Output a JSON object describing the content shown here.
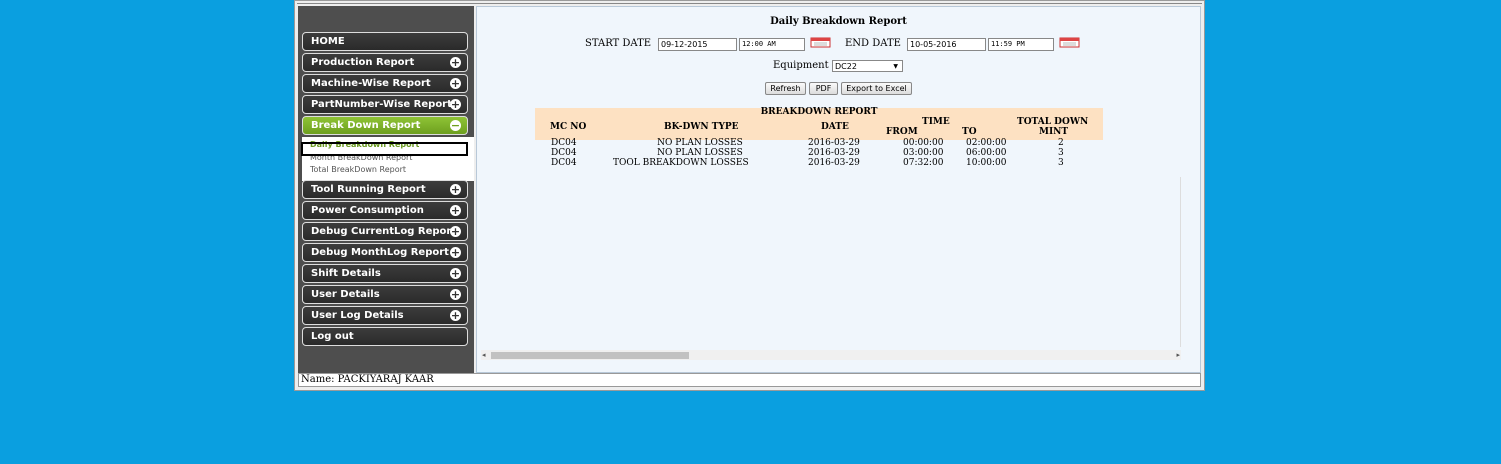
{
  "sidebar": {
    "items": [
      {
        "label": "HOME",
        "icon": ""
      },
      {
        "label": "Production Report",
        "icon": "plus-icon"
      },
      {
        "label": "Machine-Wise Report",
        "icon": "plus-icon"
      },
      {
        "label": "PartNumber-Wise Report",
        "icon": "plus-icon"
      },
      {
        "label": "Break Down Report",
        "icon": "minus-icon"
      },
      {
        "label": "Tool Running Report",
        "icon": "plus-icon"
      },
      {
        "label": "Power Consumption",
        "icon": "plus-icon"
      },
      {
        "label": "Debug CurrentLog Report",
        "icon": "plus-icon"
      },
      {
        "label": "Debug MonthLog Report",
        "icon": "plus-icon"
      },
      {
        "label": "Shift Details",
        "icon": "plus-icon"
      },
      {
        "label": "User Details",
        "icon": "plus-icon"
      },
      {
        "label": "User Log Details",
        "icon": "plus-icon"
      },
      {
        "label": "Log out",
        "icon": ""
      }
    ],
    "submenu": [
      "Daily Breakdown Report",
      "Month BreakDown Report",
      "Total BreakDown Report"
    ],
    "active_color": "#7cb22a"
  },
  "report": {
    "title": "Daily Breakdown Report",
    "start_label": "START DATE",
    "start_date": "09-12-2015",
    "start_time": "12:00 AM",
    "end_label": "END DATE",
    "end_date": "10-05-2016",
    "end_time": "11:59 PM",
    "equipment_label": "Equipment",
    "equipment_value": "DC22",
    "buttons": {
      "refresh": "Refresh",
      "pdf": "PDF",
      "excel": "Export to Excel"
    }
  },
  "table": {
    "caption": "BREAKDOWN REPORT",
    "headers": {
      "mc_no": "MC NO",
      "bk_type": "BK-DWN TYPE",
      "date": "DATE",
      "time": "TIME",
      "from": "FROM",
      "to": "TO",
      "total_1": "TOTAL DOWN",
      "total_2": "MINT"
    },
    "rows": [
      [
        "DC04",
        "NO PLAN LOSSES",
        "2016-03-29",
        "00:00:00",
        "02:00:00",
        "2"
      ],
      [
        "DC04",
        "NO PLAN LOSSES",
        "2016-03-29",
        "03:00:00",
        "06:00:00",
        "3"
      ],
      [
        "DC04",
        "TOOL BREAKDOWN LOSSES",
        "2016-03-29",
        "07:32:00",
        "10:00:00",
        "3"
      ]
    ],
    "header_color": "#fde1c2"
  },
  "footer": {
    "name": "Name: PACKIYARAJ KAAR"
  }
}
